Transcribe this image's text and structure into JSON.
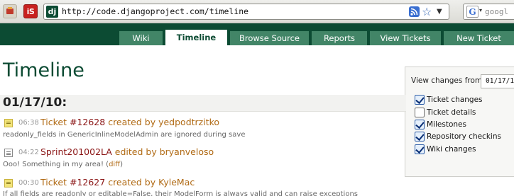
{
  "browser": {
    "url": "http://code.djangoproject.com/timeline",
    "search_placeholder": "googl",
    "favicon_text": "dj",
    "is_button_text": "iS",
    "search_engine_glyph": "G"
  },
  "nav": {
    "tabs": [
      {
        "label": "Wiki"
      },
      {
        "label": "Timeline"
      },
      {
        "label": "Browse Source"
      },
      {
        "label": "Reports"
      },
      {
        "label": "View Tickets"
      },
      {
        "label": "New Ticket"
      }
    ],
    "active": "Timeline"
  },
  "page": {
    "title": "Timeline",
    "date_heading": "01/17/10:"
  },
  "entries": [
    {
      "icon": "ticket-icon",
      "time": "06:38",
      "title_prefix": "Ticket ",
      "title_ref": "#12628",
      "title_suffix": " created by yedpodtrzitko",
      "description": "readonly_fields in GenericInlineModelAdmin are ignored during save"
    },
    {
      "icon": "wiki-page-icon",
      "time": "04:22",
      "title_ref": "Sprint201002LA",
      "title_suffix": " edited by bryanveloso",
      "description": "Ooo! Something in my area! (",
      "description_link": "diff",
      "description_end": ")"
    },
    {
      "icon": "ticket-icon",
      "time": "00:30",
      "title_prefix": "Ticket ",
      "title_ref": "#12627",
      "title_suffix": " created by KyleMac",
      "description": "If all fields are readonly or editable=False, their ModelForm is always valid and can raise exceptions"
    }
  ],
  "filters": {
    "label": "View changes from",
    "date_value": "01/17/10",
    "options": [
      {
        "label": "Ticket changes",
        "checked": true
      },
      {
        "label": "Ticket details",
        "checked": false
      },
      {
        "label": "Milestones",
        "checked": true
      },
      {
        "label": "Repository checkins",
        "checked": true
      },
      {
        "label": "Wiki changes",
        "checked": true
      }
    ]
  },
  "colors": {
    "django_green": "#0c4b33",
    "tab_green": "#428567",
    "link_orange": "#b06a14",
    "ticket_ref_red": "#8a1414"
  }
}
